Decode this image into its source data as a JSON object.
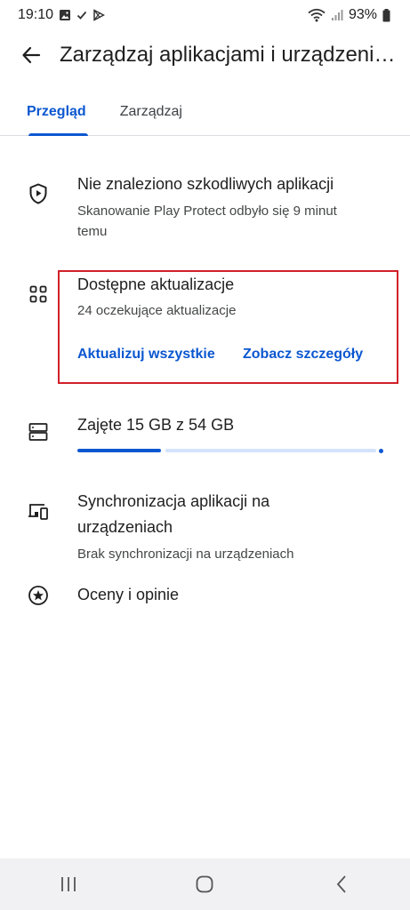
{
  "status_bar": {
    "time": "19:10",
    "battery": "93%"
  },
  "app_bar": {
    "title": "Zarządzaj aplikacjami i urządzeniami"
  },
  "tabs": [
    {
      "label": "Przegląd",
      "active": true
    },
    {
      "label": "Zarządzaj",
      "active": false
    }
  ],
  "protect": {
    "title": "Nie znaleziono szkodliwych aplikacji",
    "subtitle_line1": "Skanowanie Play Protect odbyło się 9 minut",
    "subtitle_line2": "temu"
  },
  "updates": {
    "title": "Dostępne aktualizacje",
    "subtitle": "24 oczekujące aktualizacje",
    "update_all_label": "Aktualizuj wszystkie",
    "details_label": "Zobacz szczegóły"
  },
  "storage": {
    "title": "Zajęte 15 GB z 54 GB",
    "used_fraction": 0.28
  },
  "sync": {
    "title_line1": "Synchronizacja aplikacji na",
    "title_line2": "urządzeniach",
    "subtitle": "Brak synchronizacji na urządzeniach"
  },
  "ratings": {
    "title": "Oceny i opinie"
  },
  "colors": {
    "accent": "#0b57d0",
    "highlight": "#d12029",
    "nav_bg": "#f1f1f4"
  }
}
